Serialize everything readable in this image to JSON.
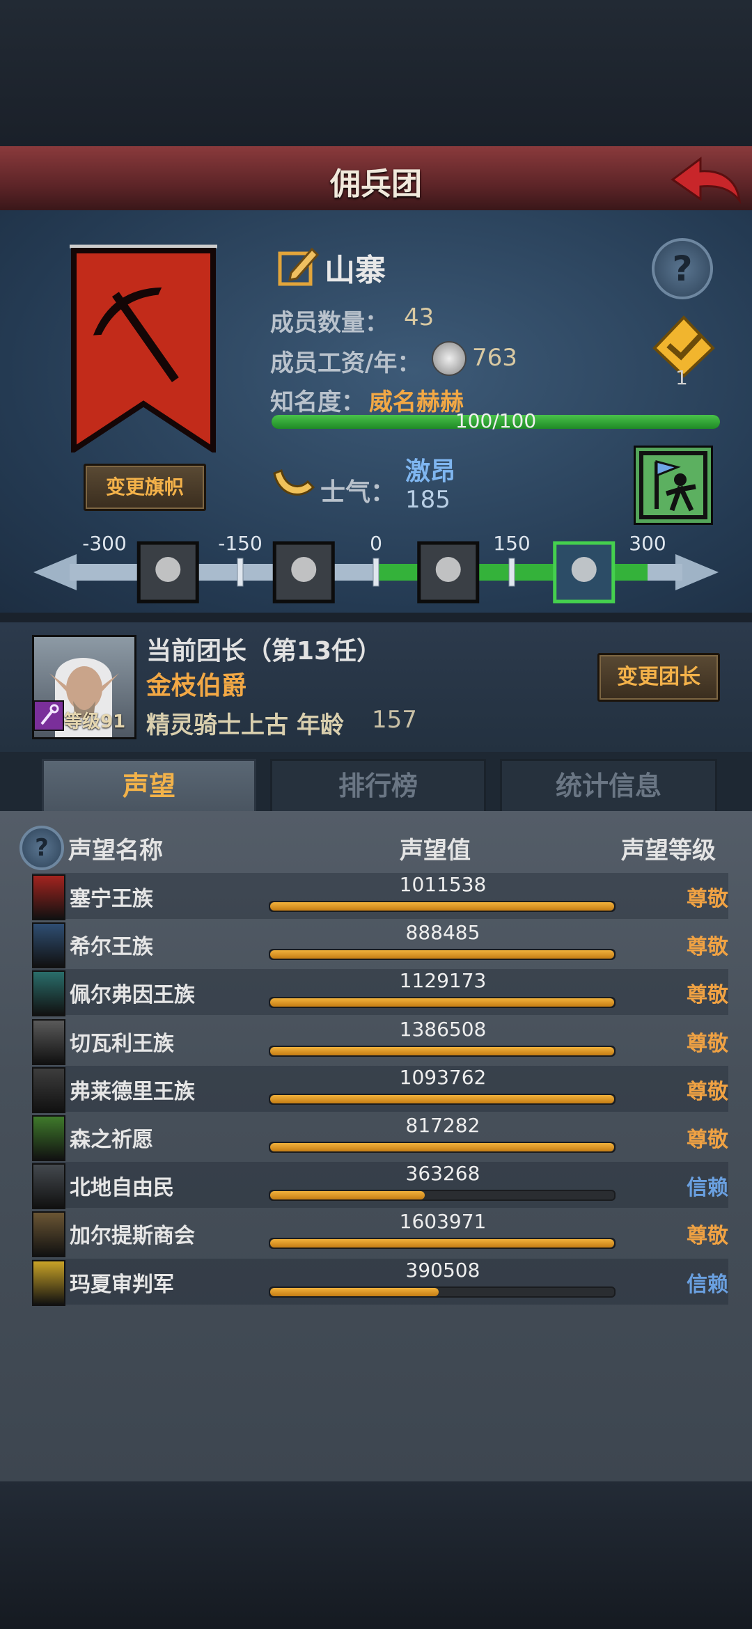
{
  "header": {
    "title": "佣兵团"
  },
  "company": {
    "name": "山寨",
    "member_label": "成员数量：",
    "member_count": "43",
    "wage_label": "成员工资/年：",
    "wage_value": "763",
    "fame_label": "知名度：",
    "fame_value": "威名赫赫",
    "fame_progress_text": "100/100",
    "fame_progress": 1.0,
    "rank_badge_number": "1",
    "change_banner_label": "变更旗帜",
    "morale_label": "士气：",
    "morale_state": "激昂",
    "morale_value": "185"
  },
  "morale_scale": {
    "ticks": [
      "-300",
      "-150",
      "0",
      "150",
      "300"
    ],
    "highlight_from": 0,
    "highlight_to": 1,
    "current_position": 0.617
  },
  "leader": {
    "title": "当前团长（第13任）",
    "name": "金枝伯爵",
    "class_age": "精灵骑士上古  年龄",
    "age": "157",
    "level_text": "等级91",
    "change_label": "变更团长"
  },
  "tabs": [
    {
      "label": "声望",
      "active": true
    },
    {
      "label": "排行榜",
      "active": false
    },
    {
      "label": "统计信息",
      "active": false
    }
  ],
  "table": {
    "headers": {
      "name": "声望名称",
      "value": "声望值",
      "level": "声望等级"
    },
    "rows": [
      {
        "name": "塞宁王族",
        "value": "1011538",
        "fill": 1.0,
        "level": "尊敬",
        "level_color": "#f0a243",
        "emblem_color": "#a3241f"
      },
      {
        "name": "希尔王族",
        "value": "888485",
        "fill": 1.0,
        "level": "尊敬",
        "level_color": "#f0a243",
        "emblem_color": "#2f4e73"
      },
      {
        "name": "佩尔弗因王族",
        "value": "1129173",
        "fill": 1.0,
        "level": "尊敬",
        "level_color": "#f0a243",
        "emblem_color": "#2a6e6b"
      },
      {
        "name": "切瓦利王族",
        "value": "1386508",
        "fill": 1.0,
        "level": "尊敬",
        "level_color": "#f0a243",
        "emblem_color": "#5a5a5a"
      },
      {
        "name": "弗莱德里王族",
        "value": "1093762",
        "fill": 1.0,
        "level": "尊敬",
        "level_color": "#f0a243",
        "emblem_color": "#3d3d3d"
      },
      {
        "name": "森之祈愿",
        "value": "817282",
        "fill": 1.0,
        "level": "尊敬",
        "level_color": "#f0a243",
        "emblem_color": "#3f7a2b"
      },
      {
        "name": "北地自由民",
        "value": "363268",
        "fill": 0.45,
        "level": "信赖",
        "level_color": "#6aa0e0",
        "emblem_color": "#44494f"
      },
      {
        "name": "加尔提斯商会",
        "value": "1603971",
        "fill": 1.0,
        "level": "尊敬",
        "level_color": "#f0a243",
        "emblem_color": "#6b5634"
      },
      {
        "name": "玛夏审判军",
        "value": "390508",
        "fill": 0.49,
        "level": "信赖",
        "level_color": "#6aa0e0",
        "emblem_color": "#c9a327"
      }
    ]
  }
}
